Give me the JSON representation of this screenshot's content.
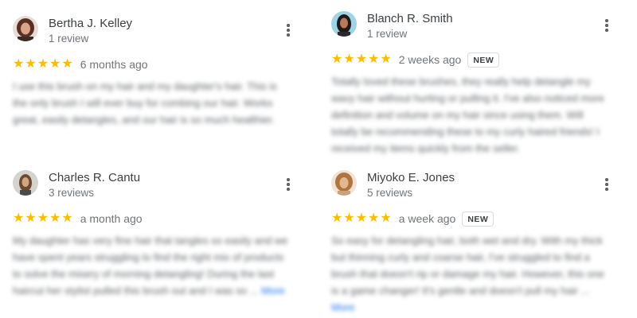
{
  "reviews": [
    {
      "name": "Bertha J. Kelley",
      "review_count": "1 review",
      "stars": "★★★★★",
      "time_ago": "6 months ago",
      "badge": "",
      "text": "I use this brush on my hair and my daughter's hair. This is the only brush I will ever buy for combing our hair. Works great, easily detangles, and our hair is so much healthier.",
      "more": ""
    },
    {
      "name": "Blanch R. Smith",
      "review_count": "1 review",
      "stars": "★★★★★",
      "time_ago": "2 weeks ago",
      "badge": "NEW",
      "text": "Totally loved these brushes, they really help detangle my wavy hair without hurting or pulling it. I've also noticed more definition and volume on my hair since using them. Will totally be recommending these to my curly haired friends! I received my items quickly from the seller.",
      "more": ""
    },
    {
      "name": "Charles R. Cantu",
      "review_count": "3 reviews",
      "stars": "★★★★★",
      "time_ago": "a month ago",
      "badge": "",
      "text": "My daughter has very fine hair that tangles so easily and we have spent years struggling to find the right mix of products to solve the misery of morning detangling! During the last haircut her stylist pulled this brush out and I was so ...",
      "more": "More"
    },
    {
      "name": "Miyoko E. Jones",
      "review_count": "5 reviews",
      "stars": "★★★★★",
      "time_ago": "a week ago",
      "badge": "NEW",
      "text": "So easy for detangling hair, both wet and dry. With my thick but thinning curly and coarse hair, I've struggled to find a brush that doesn't rip or damage my hair. However, this one is a game changer! It's gentle and doesn't pull my hair ...",
      "more": "More"
    }
  ],
  "colors": {
    "star": "#fbbc04",
    "name": "#3c4043",
    "secondary": "#70757a",
    "link": "#1a73e8"
  },
  "icons": {
    "menu": "more-vert-icon",
    "rating": "star-icon"
  }
}
